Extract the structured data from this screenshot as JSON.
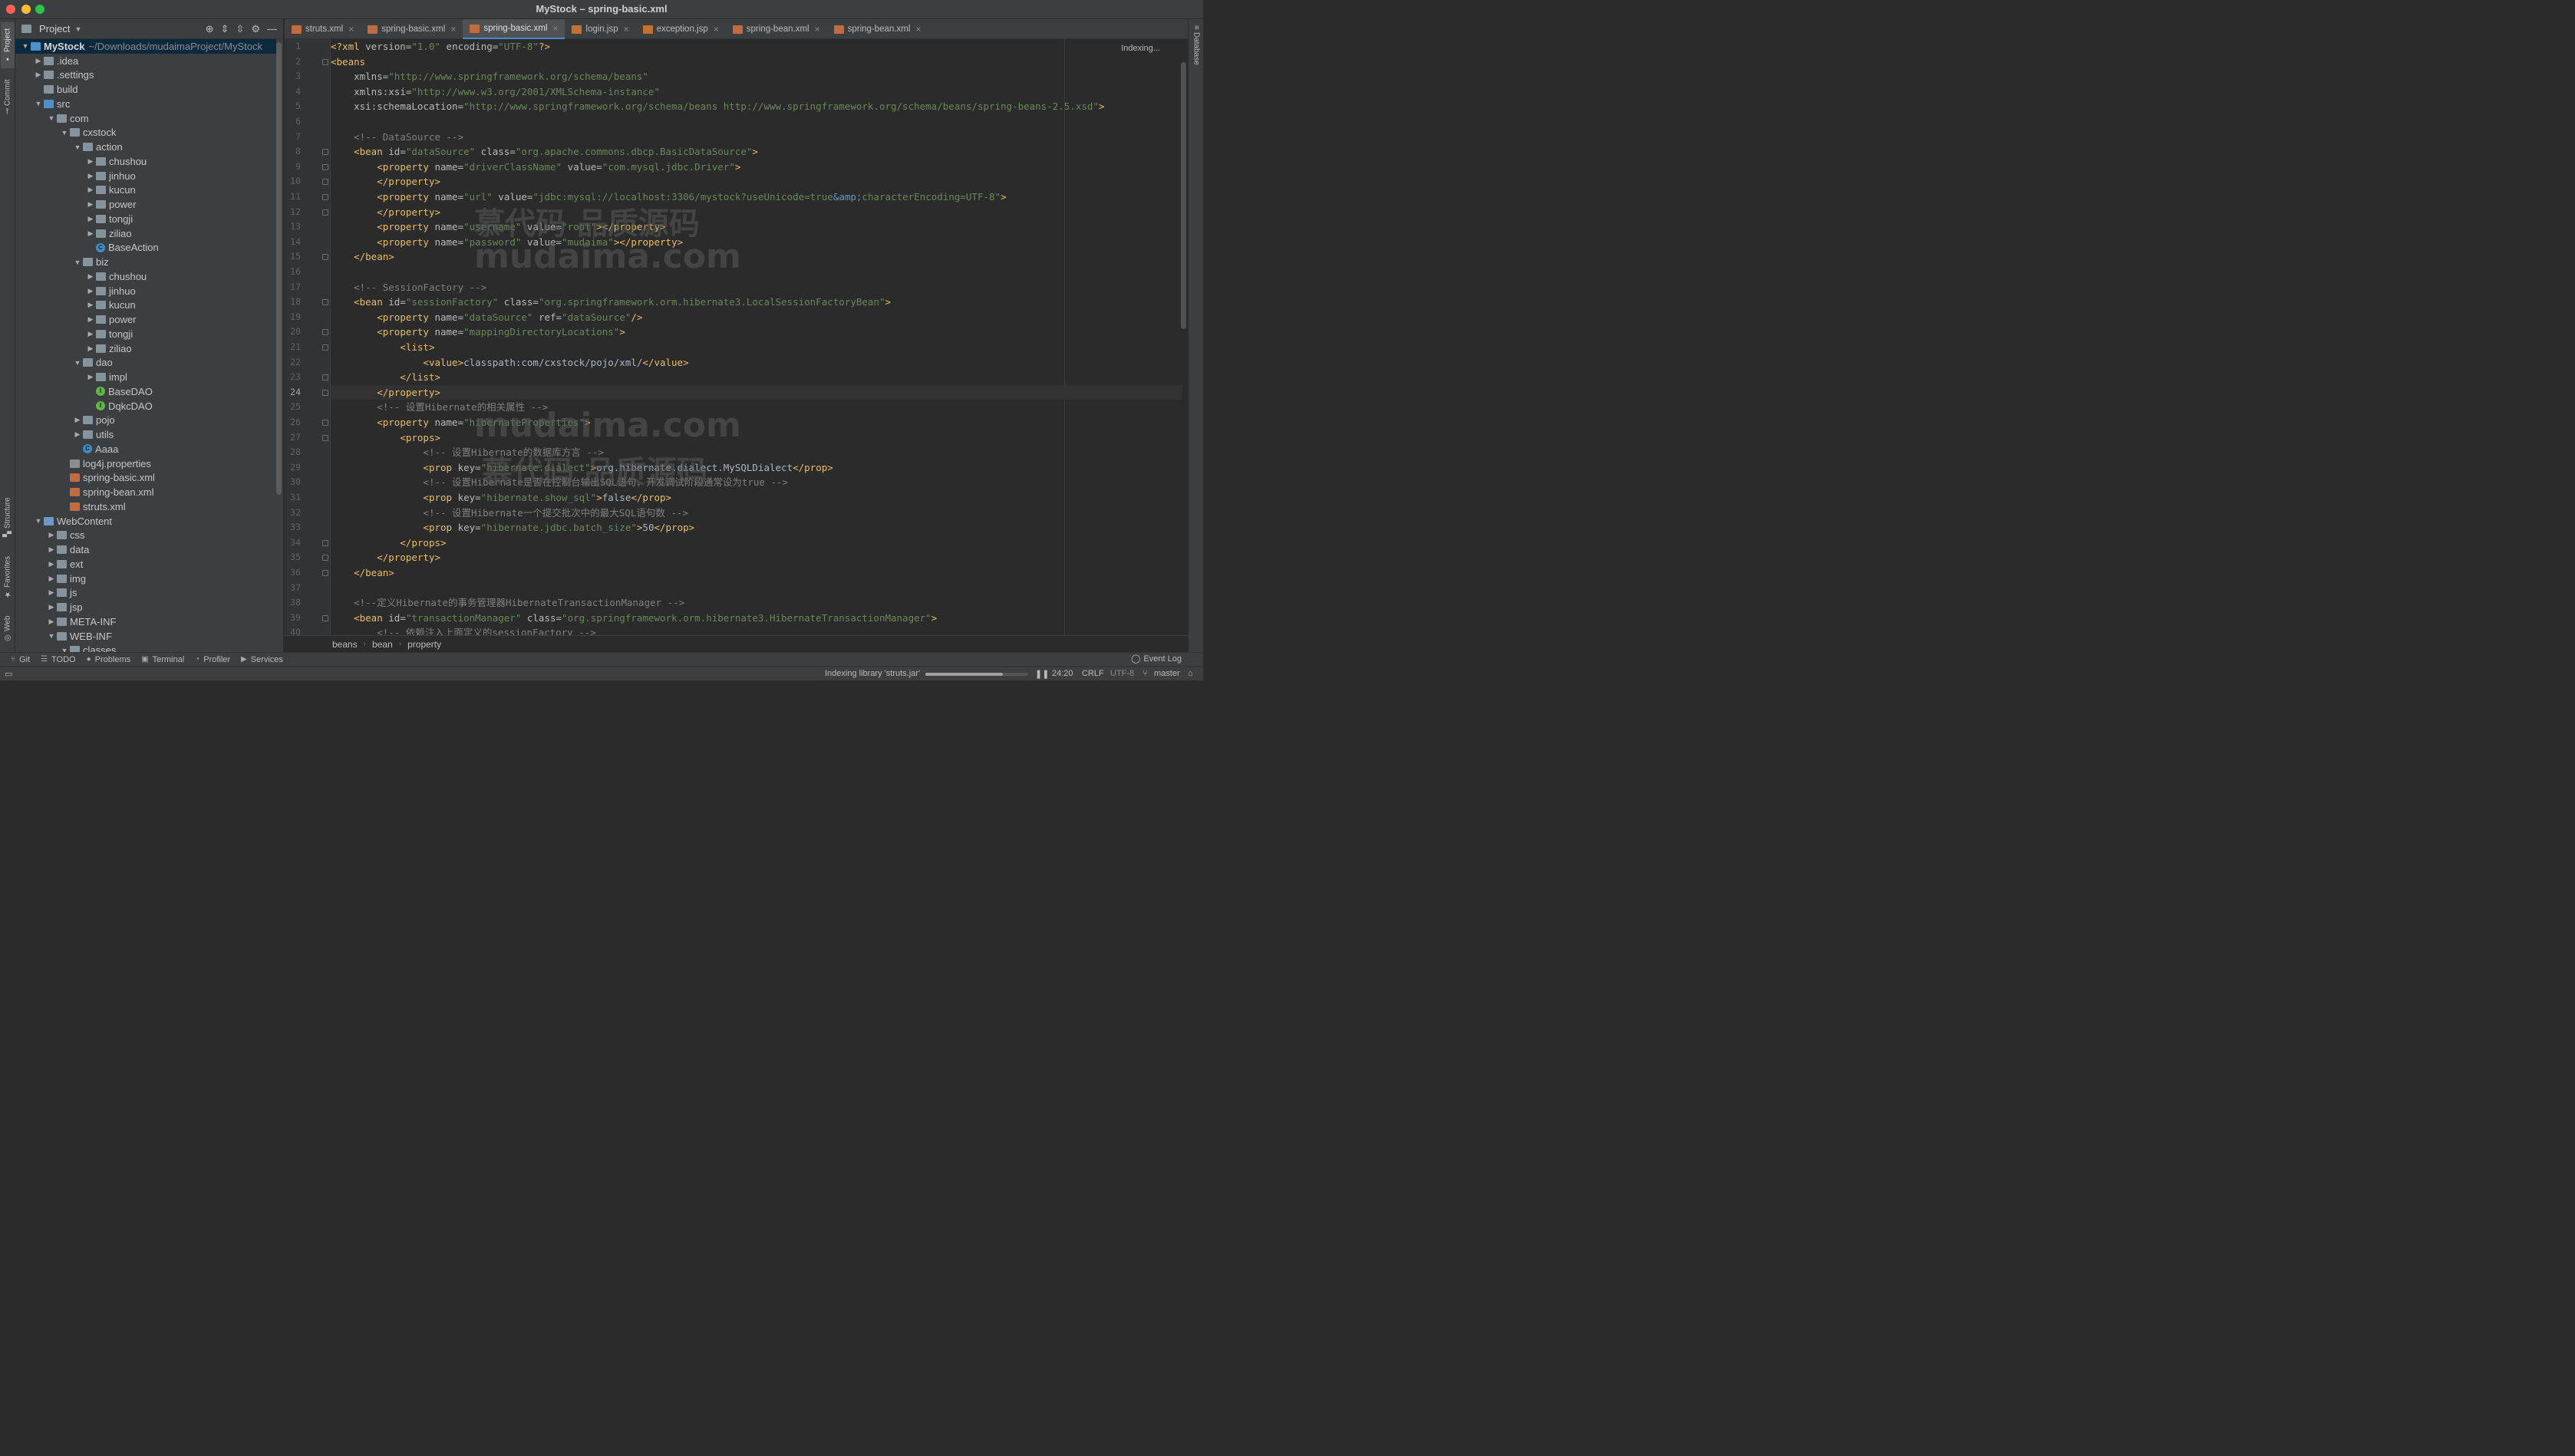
{
  "window": {
    "title": "MyStock – spring-basic.xml"
  },
  "left_strip": {
    "project": "Project",
    "commit": "Commit",
    "structure": "Structure",
    "favorites": "Favorites",
    "web": "Web"
  },
  "right_strip": {
    "database": "Database"
  },
  "project_panel": {
    "title": "Project"
  },
  "tree": [
    {
      "depth": 0,
      "arrow": "open",
      "icon": "module",
      "label": "MyStock",
      "path": "~/Downloads/mudaimaProject/MyStock",
      "bold": true,
      "selected": true
    },
    {
      "depth": 1,
      "arrow": "closed",
      "icon": "folder",
      "label": ".idea"
    },
    {
      "depth": 1,
      "arrow": "closed",
      "icon": "folder",
      "label": ".settings"
    },
    {
      "depth": 1,
      "arrow": "none",
      "icon": "folder",
      "label": "build"
    },
    {
      "depth": 1,
      "arrow": "open",
      "icon": "src",
      "label": "src"
    },
    {
      "depth": 2,
      "arrow": "open",
      "icon": "folder",
      "label": "com"
    },
    {
      "depth": 3,
      "arrow": "open",
      "icon": "folder",
      "label": "cxstock"
    },
    {
      "depth": 4,
      "arrow": "open",
      "icon": "folder",
      "label": "action"
    },
    {
      "depth": 5,
      "arrow": "closed",
      "icon": "folder",
      "label": "chushou"
    },
    {
      "depth": 5,
      "arrow": "closed",
      "icon": "folder",
      "label": "jinhuo"
    },
    {
      "depth": 5,
      "arrow": "closed",
      "icon": "folder",
      "label": "kucun"
    },
    {
      "depth": 5,
      "arrow": "closed",
      "icon": "folder",
      "label": "power"
    },
    {
      "depth": 5,
      "arrow": "closed",
      "icon": "folder",
      "label": "tongji"
    },
    {
      "depth": 5,
      "arrow": "closed",
      "icon": "folder",
      "label": "ziliao"
    },
    {
      "depth": 5,
      "arrow": "none",
      "icon": "class",
      "label": "BaseAction"
    },
    {
      "depth": 4,
      "arrow": "open",
      "icon": "folder",
      "label": "biz"
    },
    {
      "depth": 5,
      "arrow": "closed",
      "icon": "folder",
      "label": "chushou"
    },
    {
      "depth": 5,
      "arrow": "closed",
      "icon": "folder",
      "label": "jinhuo"
    },
    {
      "depth": 5,
      "arrow": "closed",
      "icon": "folder",
      "label": "kucun"
    },
    {
      "depth": 5,
      "arrow": "closed",
      "icon": "folder",
      "label": "power"
    },
    {
      "depth": 5,
      "arrow": "closed",
      "icon": "folder",
      "label": "tongji"
    },
    {
      "depth": 5,
      "arrow": "closed",
      "icon": "folder",
      "label": "ziliao"
    },
    {
      "depth": 4,
      "arrow": "open",
      "icon": "folder",
      "label": "dao"
    },
    {
      "depth": 5,
      "arrow": "closed",
      "icon": "folder",
      "label": "impl"
    },
    {
      "depth": 5,
      "arrow": "none",
      "icon": "interface",
      "label": "BaseDAO"
    },
    {
      "depth": 5,
      "arrow": "none",
      "icon": "interface",
      "label": "DqkcDAO"
    },
    {
      "depth": 4,
      "arrow": "closed",
      "icon": "folder",
      "label": "pojo"
    },
    {
      "depth": 4,
      "arrow": "closed",
      "icon": "folder",
      "label": "utils"
    },
    {
      "depth": 4,
      "arrow": "none",
      "icon": "class",
      "label": "Aaaa"
    },
    {
      "depth": 3,
      "arrow": "none",
      "icon": "properties",
      "label": "log4j.properties"
    },
    {
      "depth": 3,
      "arrow": "none",
      "icon": "xml",
      "label": "spring-basic.xml"
    },
    {
      "depth": 3,
      "arrow": "none",
      "icon": "xml",
      "label": "spring-bean.xml"
    },
    {
      "depth": 3,
      "arrow": "none",
      "icon": "xml",
      "label": "struts.xml"
    },
    {
      "depth": 1,
      "arrow": "open",
      "icon": "web",
      "label": "WebContent"
    },
    {
      "depth": 2,
      "arrow": "closed",
      "icon": "folder",
      "label": "css"
    },
    {
      "depth": 2,
      "arrow": "closed",
      "icon": "folder",
      "label": "data"
    },
    {
      "depth": 2,
      "arrow": "closed",
      "icon": "folder",
      "label": "ext"
    },
    {
      "depth": 2,
      "arrow": "closed",
      "icon": "folder",
      "label": "img"
    },
    {
      "depth": 2,
      "arrow": "closed",
      "icon": "folder",
      "label": "js"
    },
    {
      "depth": 2,
      "arrow": "closed",
      "icon": "folder",
      "label": "jsp"
    },
    {
      "depth": 2,
      "arrow": "closed",
      "icon": "folder",
      "label": "META-INF"
    },
    {
      "depth": 2,
      "arrow": "open",
      "icon": "folder",
      "label": "WEB-INF"
    },
    {
      "depth": 3,
      "arrow": "open",
      "icon": "folder",
      "label": "classes"
    }
  ],
  "tabs": [
    {
      "label": "struts.xml",
      "icon": "xml",
      "active": false
    },
    {
      "label": "spring-basic.xml",
      "icon": "xml",
      "active": false
    },
    {
      "label": "spring-basic.xml",
      "icon": "xml",
      "active": true
    },
    {
      "label": "login.jsp",
      "icon": "jsp",
      "active": false
    },
    {
      "label": "exception.jsp",
      "icon": "jsp",
      "active": false
    },
    {
      "label": "spring-bean.xml",
      "icon": "xml",
      "active": false
    },
    {
      "label": "spring-bean.xml",
      "icon": "xml",
      "active": false
    }
  ],
  "editor": {
    "indexing_label": "Indexing...",
    "current_line": 24,
    "lines": [
      [
        [
          "t",
          "<?xml "
        ],
        [
          "a",
          "version="
        ],
        [
          "v",
          "\"1.0\""
        ],
        [
          "a",
          " encoding="
        ],
        [
          "v",
          "\"UTF-8\""
        ],
        [
          "t",
          "?>"
        ]
      ],
      [
        [
          "t",
          "<beans"
        ]
      ],
      [
        [
          "p",
          "    "
        ],
        [
          "a",
          "xmlns="
        ],
        [
          "v",
          "\"http://www.springframework.org/schema/beans\""
        ]
      ],
      [
        [
          "p",
          "    "
        ],
        [
          "a",
          "xmlns:xsi="
        ],
        [
          "v",
          "\"http://www.w3.org/2001/XMLSchema-instance\""
        ]
      ],
      [
        [
          "p",
          "    "
        ],
        [
          "a",
          "xsi:schemaLocation="
        ],
        [
          "v",
          "\"http://www.springframework.org/schema/beans http://www.springframework.org/schema/beans/spring-beans-2.5.xsd\""
        ],
        [
          "t",
          ">"
        ]
      ],
      [],
      [
        [
          "p",
          "    "
        ],
        [
          "c",
          "<!-- DataSource -->"
        ]
      ],
      [
        [
          "p",
          "    "
        ],
        [
          "t",
          "<bean "
        ],
        [
          "a",
          "id="
        ],
        [
          "v",
          "\"dataSource\""
        ],
        [
          "a",
          " class="
        ],
        [
          "v",
          "\"org.apache.commons.dbcp.BasicDataSource\""
        ],
        [
          "t",
          ">"
        ]
      ],
      [
        [
          "p",
          "        "
        ],
        [
          "t",
          "<property "
        ],
        [
          "a",
          "name="
        ],
        [
          "v",
          "\"driverClassName\""
        ],
        [
          "a",
          " value="
        ],
        [
          "v",
          "\"com.mysql.jdbc.Driver\""
        ],
        [
          "t",
          ">"
        ]
      ],
      [
        [
          "p",
          "        "
        ],
        [
          "t",
          "</property>"
        ]
      ],
      [
        [
          "p",
          "        "
        ],
        [
          "t",
          "<property "
        ],
        [
          "a",
          "name="
        ],
        [
          "v",
          "\"url\""
        ],
        [
          "a",
          " value="
        ],
        [
          "v",
          "\"jdbc:mysql://localhost:3306/mystock?useUnicode=true"
        ],
        [
          "e",
          "&amp;"
        ],
        [
          "v",
          "characterEncoding=UTF-8\""
        ],
        [
          "t",
          ">"
        ]
      ],
      [
        [
          "p",
          "        "
        ],
        [
          "t",
          "</property>"
        ]
      ],
      [
        [
          "p",
          "        "
        ],
        [
          "t",
          "<property "
        ],
        [
          "a",
          "name="
        ],
        [
          "v",
          "\"username\""
        ],
        [
          "a",
          " value="
        ],
        [
          "v",
          "\"root\""
        ],
        [
          "t",
          "></property>"
        ]
      ],
      [
        [
          "p",
          "        "
        ],
        [
          "t",
          "<property "
        ],
        [
          "a",
          "name="
        ],
        [
          "v",
          "\"password\""
        ],
        [
          "a",
          " value="
        ],
        [
          "v",
          "\"mudaima\""
        ],
        [
          "t",
          "></property>"
        ]
      ],
      [
        [
          "p",
          "    "
        ],
        [
          "t",
          "</bean>"
        ]
      ],
      [],
      [
        [
          "p",
          "    "
        ],
        [
          "c",
          "<!-- SessionFactory -->"
        ]
      ],
      [
        [
          "p",
          "    "
        ],
        [
          "t",
          "<bean "
        ],
        [
          "a",
          "id="
        ],
        [
          "v",
          "\"sessionFactory\""
        ],
        [
          "a",
          " class="
        ],
        [
          "v",
          "\"org.springframework.orm.hibernate3.LocalSessionFactoryBean\""
        ],
        [
          "t",
          ">"
        ]
      ],
      [
        [
          "p",
          "        "
        ],
        [
          "t",
          "<property "
        ],
        [
          "a",
          "name="
        ],
        [
          "v",
          "\"dataSource\""
        ],
        [
          "a",
          " ref="
        ],
        [
          "v",
          "\"dataSource\""
        ],
        [
          "t",
          "/>"
        ]
      ],
      [
        [
          "p",
          "        "
        ],
        [
          "t",
          "<property "
        ],
        [
          "a",
          "name="
        ],
        [
          "v",
          "\"mappingDirectoryLocations\""
        ],
        [
          "t",
          ">"
        ]
      ],
      [
        [
          "p",
          "            "
        ],
        [
          "t",
          "<list>"
        ]
      ],
      [
        [
          "p",
          "                "
        ],
        [
          "t",
          "<value>"
        ],
        [
          "p",
          "classpath:com/cxstock/pojo/xml/"
        ],
        [
          "t",
          "</value>"
        ]
      ],
      [
        [
          "p",
          "            "
        ],
        [
          "t",
          "</list>"
        ]
      ],
      [
        [
          "p",
          "        "
        ],
        [
          "t",
          "</property>"
        ]
      ],
      [
        [
          "p",
          "        "
        ],
        [
          "c",
          "<!-- 设置Hibernate的相关属性 -->"
        ]
      ],
      [
        [
          "p",
          "        "
        ],
        [
          "t",
          "<property "
        ],
        [
          "a",
          "name="
        ],
        [
          "v",
          "\"hibernateProperties\""
        ],
        [
          "t",
          ">"
        ]
      ],
      [
        [
          "p",
          "            "
        ],
        [
          "t",
          "<props>"
        ]
      ],
      [
        [
          "p",
          "                "
        ],
        [
          "c",
          "<!-- 设置Hibernate的数据库方言 -->"
        ]
      ],
      [
        [
          "p",
          "                "
        ],
        [
          "t",
          "<prop "
        ],
        [
          "a",
          "key="
        ],
        [
          "v",
          "\"hibernate.dialect\""
        ],
        [
          "t",
          ">"
        ],
        [
          "p",
          "org.hibernate.dialect.MySQLDialect"
        ],
        [
          "t",
          "</prop>"
        ]
      ],
      [
        [
          "p",
          "                "
        ],
        [
          "c",
          "<!-- 设置Hibernate是否在控制台输出SQL语句，开发调试阶段通常设为true -->"
        ]
      ],
      [
        [
          "p",
          "                "
        ],
        [
          "t",
          "<prop "
        ],
        [
          "a",
          "key="
        ],
        [
          "v",
          "\"hibernate.show_sql\""
        ],
        [
          "t",
          ">"
        ],
        [
          "p",
          "false"
        ],
        [
          "t",
          "</prop>"
        ]
      ],
      [
        [
          "p",
          "                "
        ],
        [
          "c",
          "<!-- 设置Hibernate一个提交批次中的最大SQL语句数 -->"
        ]
      ],
      [
        [
          "p",
          "                "
        ],
        [
          "t",
          "<prop "
        ],
        [
          "a",
          "key="
        ],
        [
          "v",
          "\"hibernate.jdbc.batch_size\""
        ],
        [
          "t",
          ">"
        ],
        [
          "p",
          "50"
        ],
        [
          "t",
          "</prop>"
        ]
      ],
      [
        [
          "p",
          "            "
        ],
        [
          "t",
          "</props>"
        ]
      ],
      [
        [
          "p",
          "        "
        ],
        [
          "t",
          "</property>"
        ]
      ],
      [
        [
          "p",
          "    "
        ],
        [
          "t",
          "</bean>"
        ]
      ],
      [],
      [
        [
          "p",
          "    "
        ],
        [
          "c",
          "<!--定义Hibernate的事务管理器HibernateTransactionManager -->"
        ]
      ],
      [
        [
          "p",
          "    "
        ],
        [
          "t",
          "<bean "
        ],
        [
          "a",
          "id="
        ],
        [
          "v",
          "\"transactionManager\""
        ],
        [
          "a",
          " class="
        ],
        [
          "v",
          "\"org.springframework.orm.hibernate3.HibernateTransactionManager\""
        ],
        [
          "t",
          ">"
        ]
      ],
      [
        [
          "p",
          "        "
        ],
        [
          "c",
          "<!-- 依赖注入上面定义的sessionFactory -->"
        ]
      ]
    ],
    "watermarks": [
      "慕代码 品质源码",
      "mudaima.com",
      "mudaima.com",
      "慕代码 品质源码"
    ]
  },
  "breadcrumbs": [
    "beans",
    "bean",
    "property"
  ],
  "tool_windows": [
    {
      "icon": "git-icon",
      "label": "Git"
    },
    {
      "icon": "todo-icon",
      "label": "TODO"
    },
    {
      "icon": "problems-icon",
      "label": "Problems"
    },
    {
      "icon": "terminal-icon",
      "label": "Terminal"
    },
    {
      "icon": "profiler-icon",
      "label": "Profiler"
    },
    {
      "icon": "services-icon",
      "label": "Services"
    }
  ],
  "event_log": "Event Log",
  "status": {
    "indexing": "Indexing library 'struts.jar'",
    "progress": 0.75,
    "position": "24:20",
    "line_sep": "CRLF",
    "encoding": "UTF-8",
    "branch": "master"
  },
  "colors": {
    "accent": "#4a88c7",
    "tag": "#e8bf6a",
    "attr_value": "#6a8759",
    "comment": "#808080",
    "entity": "#6897bb"
  }
}
